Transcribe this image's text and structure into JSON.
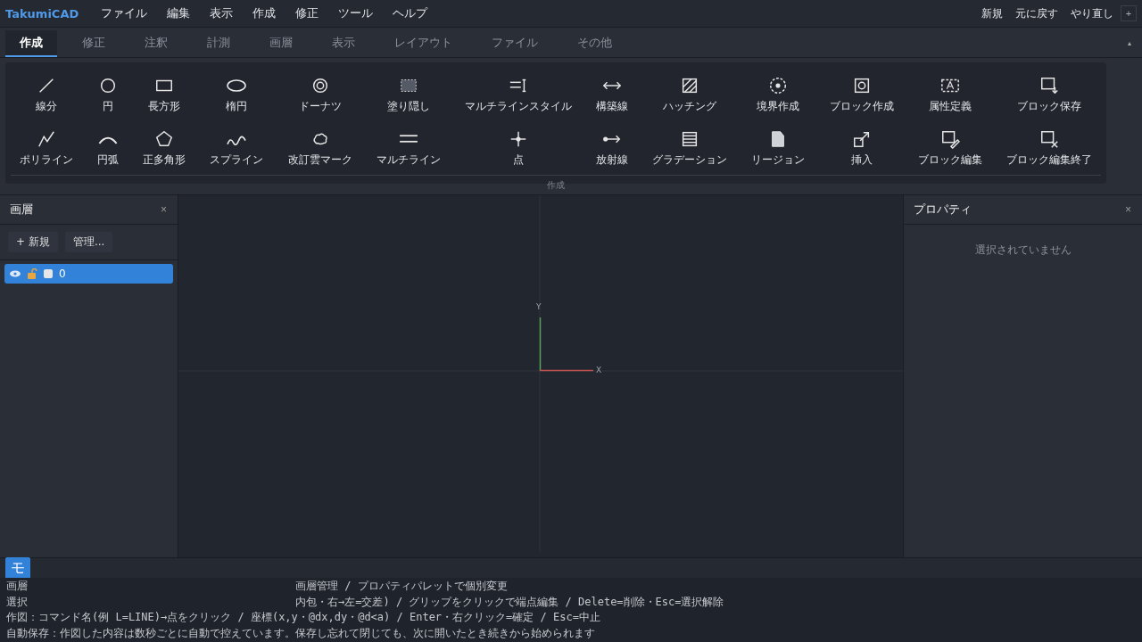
{
  "app_name": "TakumiCAD",
  "menu": [
    "ファイル",
    "編集",
    "表示",
    "作成",
    "修正",
    "ツール",
    "ヘルプ"
  ],
  "actions": [
    "新規",
    "元に戻す",
    "やり直し"
  ],
  "add_button": "+",
  "tabs": [
    {
      "label": "作成",
      "selected": true
    },
    {
      "label": "修正",
      "selected": false
    },
    {
      "label": "注釈",
      "selected": false
    },
    {
      "label": "計測",
      "selected": false
    },
    {
      "label": "画層",
      "selected": false
    },
    {
      "label": "表示",
      "selected": false
    },
    {
      "label": "レイアウト",
      "selected": false
    },
    {
      "label": "ファイル",
      "selected": false
    },
    {
      "label": "その他",
      "selected": false
    }
  ],
  "collapse_button": "▴",
  "ribbon": {
    "group": "作成",
    "tools": [
      "線分",
      "円",
      "長方形",
      "楕円",
      "ドーナツ",
      "塗り隠し",
      "マルチラインスタイル",
      "構築線",
      "ハッチング",
      "境界作成",
      "ブロック作成",
      "属性定義",
      "ブロック保存",
      "ポリライン",
      "円弧",
      "正多角形",
      "スプライン",
      "改訂雲マーク",
      "マルチライン",
      "点",
      "放射線",
      "グラデーション",
      "リージョン",
      "挿入",
      "ブロック編集",
      "ブロック編集終了"
    ]
  },
  "layers_panel": {
    "title": "画層",
    "close": "×",
    "new_button": "+ 新規",
    "manage_button": "管理...",
    "layers": [
      {
        "name": "0",
        "selected": true
      }
    ]
  },
  "canvas": {
    "y_label": "Y",
    "x_label": "X"
  },
  "properties_panel": {
    "title": "プロパティ",
    "close": "×",
    "empty_text": "選択されていません"
  },
  "status_bar": {
    "mode_button": "モ"
  },
  "help_lines": [
    {
      "start": "画層",
      "rest": "画層管理 / プロパティパレットで個別変更"
    },
    {
      "start": "選択",
      "rest": "内包・右→左=交差) / グリップをクリックで端点編集 / Delete=削除・Esc=選択解除"
    },
    {
      "start": "作図：コマンド名(例 L=LINE)→点をクリック / 座標(x,y・@dx,dy・@d<a) / Enter・右クリック=確定 / Esc=中止"
    },
    {
      "start": "自動保存：作図した内容は数秒ごとに自動で控えています。保存し忘れて閉じても、次に開いたとき続きから始められます"
    }
  ]
}
